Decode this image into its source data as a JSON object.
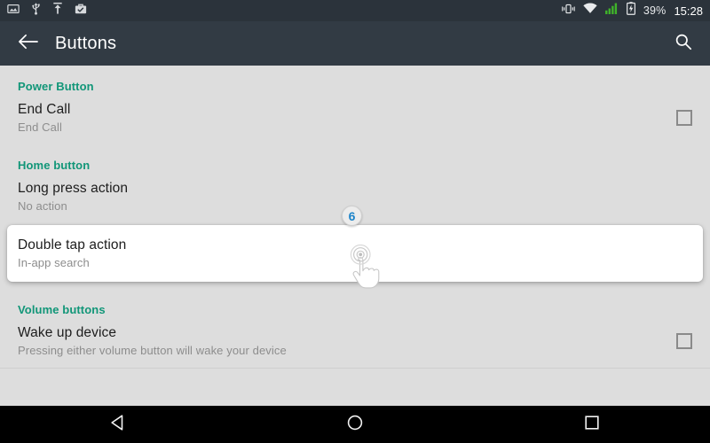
{
  "status_bar": {
    "left_icons": [
      {
        "name": "screenshot-icon",
        "label": "screenshot"
      },
      {
        "name": "usb-icon",
        "label": "usb"
      },
      {
        "name": "upload-icon",
        "label": "upload"
      },
      {
        "name": "work-profile-icon",
        "label": "work profile"
      }
    ],
    "right_icons": [
      {
        "name": "vibrate-icon",
        "label": "vibrate"
      },
      {
        "name": "wifi-icon",
        "label": "wifi"
      },
      {
        "name": "signal-icon",
        "label": "signal"
      },
      {
        "name": "battery-charging-icon",
        "label": "battery charging"
      }
    ],
    "battery_percent": "39%",
    "clock": "15:28",
    "signal_color": "#3fb32a",
    "background": "#2b333b"
  },
  "action_bar": {
    "back_icon": "arrow-back-icon",
    "title": "Buttons",
    "search_icon": "search-icon",
    "background": "#323b44"
  },
  "content": {
    "background": "#dddddd",
    "accent_color": "#119678",
    "sections": [
      {
        "header": "Power Button",
        "rows": [
          {
            "title": "End Call",
            "subtitle": "End Call",
            "control": "checkbox",
            "checked": false
          }
        ]
      },
      {
        "header": "Home button",
        "rows": [
          {
            "title": "Long press action",
            "subtitle": "No action",
            "control": "none",
            "checked": false
          },
          {
            "title": "Double tap action",
            "subtitle": "In-app search",
            "control": "none",
            "checked": false,
            "highlighted": true
          }
        ]
      },
      {
        "header": "Volume buttons",
        "rows": [
          {
            "title": "Wake up device",
            "subtitle": "Pressing either volume button will wake your device",
            "control": "checkbox",
            "checked": false
          }
        ]
      }
    ]
  },
  "annotation": {
    "step_number": "6",
    "step_number_color": "#1b83c9",
    "cursor_icon": "tap-hand-cursor-icon"
  },
  "nav_bar": {
    "background": "#000000",
    "buttons": [
      {
        "name": "nav-back-button",
        "label": "Back"
      },
      {
        "name": "nav-home-button",
        "label": "Home"
      },
      {
        "name": "nav-recents-button",
        "label": "Recents"
      }
    ]
  }
}
